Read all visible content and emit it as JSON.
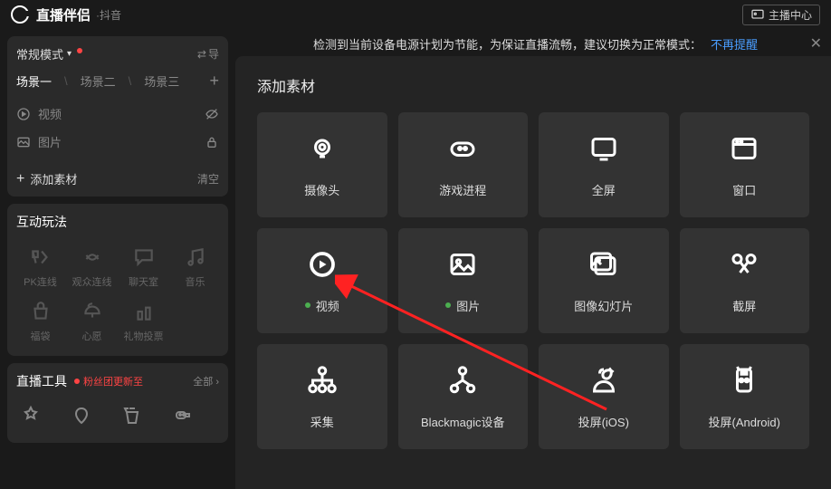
{
  "app": {
    "title": "直播伴侣",
    "subtitle": "·抖音",
    "broadcast_center": "主播中心"
  },
  "mode": {
    "label": "常规模式",
    "swap": "导"
  },
  "scenes": {
    "tabs": [
      "场景一",
      "场景二",
      "场景三"
    ]
  },
  "sources": {
    "video": "视频",
    "image": "图片"
  },
  "add_src": {
    "label": "添加素材",
    "clear": "清空"
  },
  "interact": {
    "title": "互动玩法",
    "items": [
      "PK连线",
      "观众连线",
      "聊天室",
      "音乐",
      "福袋",
      "心愿",
      "礼物投票",
      ""
    ]
  },
  "tools": {
    "title": "直播工具",
    "badge": "粉丝团更新至",
    "all": "全部"
  },
  "notice": {
    "text": "检测到当前设备电源计划为节能，为保证直播流畅，建议切换为正常模式：",
    "link": "不再提醒"
  },
  "modal": {
    "title": "添加素材",
    "items": [
      {
        "label": "摄像头",
        "dot": false
      },
      {
        "label": "游戏进程",
        "dot": false
      },
      {
        "label": "全屏",
        "dot": false
      },
      {
        "label": "窗口",
        "dot": false
      },
      {
        "label": "视频",
        "dot": true
      },
      {
        "label": "图片",
        "dot": true
      },
      {
        "label": "图像幻灯片",
        "dot": false
      },
      {
        "label": "截屏",
        "dot": false
      },
      {
        "label": "采集",
        "dot": false
      },
      {
        "label": "Blackmagic设备",
        "dot": false
      },
      {
        "label": "投屏(iOS)",
        "dot": false
      },
      {
        "label": "投屏(Android)",
        "dot": false
      }
    ]
  }
}
